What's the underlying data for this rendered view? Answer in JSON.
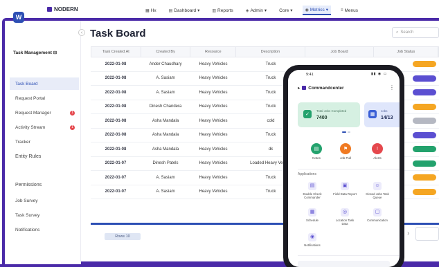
{
  "app": {
    "logo_text": "NODERN"
  },
  "topnav": {
    "items": [
      {
        "label": "Hx",
        "icon": "grid-icon",
        "active": false
      },
      {
        "label": "Dashboard",
        "icon": "dashboard-icon",
        "active": false
      },
      {
        "label": "Reports",
        "icon": "chart-icon",
        "active": false
      },
      {
        "label": "Admin",
        "icon": "shield-icon",
        "active": false
      },
      {
        "label": "Core",
        "icon": "gear-icon",
        "active": false
      },
      {
        "label": "Metrics",
        "icon": "metrics-icon",
        "active": true
      },
      {
        "label": "Menus",
        "icon": "list-icon",
        "active": false
      }
    ]
  },
  "sidebar": {
    "brand_initial": "W",
    "workspace": "Task Management",
    "items": [
      {
        "label": "Task Board",
        "active": true,
        "badge": ""
      },
      {
        "label": "Request Portal",
        "active": false,
        "badge": ""
      },
      {
        "label": "Request Manager",
        "active": false,
        "badge": "1"
      },
      {
        "label": "Activity Stream",
        "active": false,
        "badge": "1"
      },
      {
        "label": "Tracker",
        "active": false,
        "badge": ""
      },
      {
        "label": "Entity Rules",
        "active": false,
        "badge": ""
      }
    ],
    "section_title": "Permissions",
    "section_items": [
      "Job Survey",
      "Task Survey",
      "Notifications"
    ]
  },
  "main": {
    "title": "Task Board",
    "search_placeholder": "Search",
    "columns": [
      "Task Created At",
      "Created By",
      "Resource",
      "Description",
      "Job Board",
      "Job Status"
    ],
    "rows": [
      {
        "date": "2022-01-08",
        "by": "Ander Chaudhary",
        "res": "Heavy Vehicles",
        "desc": "Truck",
        "status_color": "#f5a623"
      },
      {
        "date": "2022-01-08",
        "by": "A. Sasiam",
        "res": "Heavy Vehicles",
        "desc": "Truck",
        "status_color": "#5b4fd1"
      },
      {
        "date": "2022-01-08",
        "by": "A. Sasiam",
        "res": "Heavy Vehicles",
        "desc": "Truck",
        "status_color": "#5b4fd1"
      },
      {
        "date": "2022-01-08",
        "by": "Dinesh Chandera",
        "res": "Heavy Vehicles",
        "desc": "Truck",
        "status_color": "#f5a623"
      },
      {
        "date": "2022-01-08",
        "by": "Asha Mandala",
        "res": "Heavy Vehicles",
        "desc": "cold",
        "status_color": "#b5b8c2"
      },
      {
        "date": "2022-01-08",
        "by": "Asha Mandala",
        "res": "Heavy Vehicles",
        "desc": "Truck",
        "status_color": "#5b4fd1"
      },
      {
        "date": "2022-01-08",
        "by": "Asha Mandala",
        "res": "Heavy Vehicles",
        "desc": "dk",
        "status_color": "#23a26d"
      },
      {
        "date": "2022-01-07",
        "by": "Dinesh Patels",
        "res": "Heavy Vehicles",
        "desc": "Loaded Heavy Vehicle",
        "status_color": "#23a26d"
      },
      {
        "date": "2022-01-07",
        "by": "A. Sasiam",
        "res": "Heavy Vehicles",
        "desc": "Truck",
        "status_color": "#f5a623"
      },
      {
        "date": "2022-01-07",
        "by": "A. Sasiam",
        "res": "Heavy Vehicles",
        "desc": "Truck",
        "status_color": "#f5a623"
      }
    ],
    "footer_button": "Rows 10"
  },
  "phone": {
    "time": "9:41",
    "status_icons": "▮▮ ◉ ▭",
    "header_title": "Commandcenter",
    "card1": {
      "label": "Total Jobs Completed",
      "value": "7400"
    },
    "card2": {
      "label": "Jobs",
      "value": "14/13"
    },
    "quick_actions": [
      {
        "label": "Notes",
        "color": "#23a26d",
        "icon": "note-icon"
      },
      {
        "label": "Job Pull",
        "color": "#f07a22",
        "icon": "flag-icon"
      },
      {
        "label": "Alerts",
        "color": "#e5484d",
        "icon": "alert-icon"
      }
    ],
    "section_title": "Applications",
    "grid": [
      {
        "label": "Double Check Commander",
        "icon": "doc-icon"
      },
      {
        "label": "Field Data Report",
        "icon": "form-icon"
      },
      {
        "label": "Closed Jobs Task Queue",
        "icon": "person-icon"
      },
      {
        "label": "Schedule",
        "icon": "calendar-icon"
      },
      {
        "label": "Location Task Data",
        "icon": "pin-icon"
      },
      {
        "label": "Communication",
        "icon": "chat-icon"
      },
      {
        "label": "Notifications",
        "icon": "bell-icon"
      }
    ]
  }
}
